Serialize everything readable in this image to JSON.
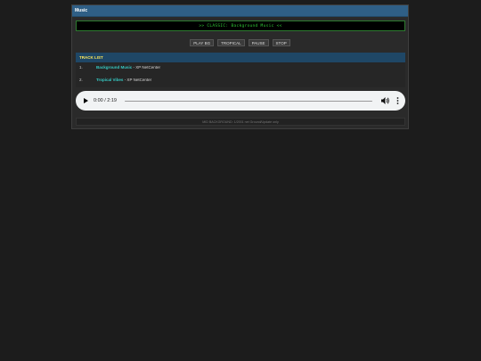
{
  "window": {
    "title": "Music"
  },
  "display": {
    "text": ">> CLASSIC: Background Music <<"
  },
  "controls": [
    {
      "label": "PLAY BG"
    },
    {
      "label": "TROPICAL"
    },
    {
      "label": "PAUSE"
    },
    {
      "label": "STOP"
    }
  ],
  "tracklist": {
    "header": "TRACK LIST",
    "tracks": [
      {
        "num": "1.",
        "name": "Background Music",
        "artist": " - XP NetCenter"
      },
      {
        "num": "2.",
        "name": "Tropical Vibes",
        "artist": " - XP NetCenter"
      }
    ]
  },
  "player": {
    "time": "0:00 / 2:19",
    "progress": 0
  },
  "status": {
    "text": "MID BACKGROUND: 1/2001 net Ground/Update only"
  },
  "colors": {
    "titlebar": "#2f5f86",
    "lcd_text": "#2ec935",
    "track_name": "#36c9c3",
    "header_text": "#ffe85a"
  }
}
